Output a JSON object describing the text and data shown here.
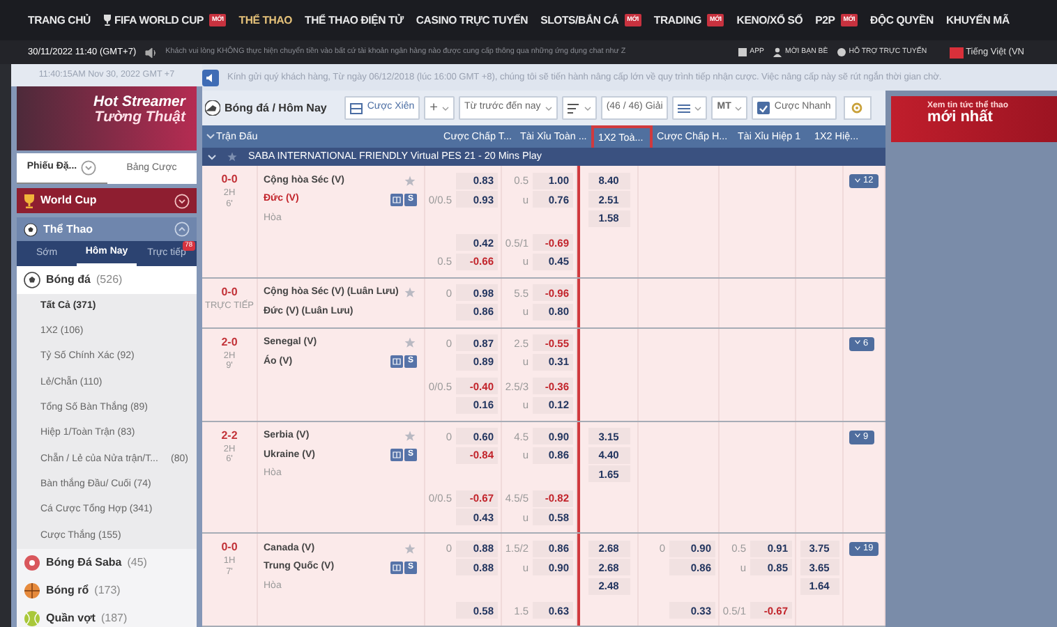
{
  "top_nav": [
    {
      "label": "TRANG CHỦ",
      "selected": false,
      "trophy": false
    },
    {
      "label": "FIFA WORLD CUP",
      "selected": false,
      "trophy": true,
      "badge": "MỚI"
    },
    {
      "label": "THỂ THAO",
      "selected": true,
      "trophy": false
    },
    {
      "label": "THỂ THAO ĐIỆN TỬ",
      "selected": false,
      "trophy": false
    },
    {
      "label": "CASINO TRỰC TUYẾN",
      "selected": false,
      "trophy": false
    },
    {
      "label": "SLOTS/BẮN CÁ",
      "selected": false,
      "trophy": false,
      "badge": "MỚI"
    },
    {
      "label": "TRADING",
      "selected": false,
      "trophy": false,
      "badge": "MỚI"
    },
    {
      "label": "KENO/XỔ SỐ",
      "selected": false,
      "trophy": false
    },
    {
      "label": "P2P",
      "selected": false,
      "trophy": false,
      "badge": "MỚI"
    },
    {
      "label": "ĐỘC QUYỀN",
      "selected": false,
      "trophy": false
    },
    {
      "label": "KHUYẾN MÃ",
      "selected": false,
      "trophy": false
    }
  ],
  "info_bar": {
    "datetime": "30/11/2022 11:40 (GMT+7)",
    "marquee": "Khách vui lòng KHÔNG thực hiện chuyển tiền vào bất cứ tài khoản ngân hàng nào được cung cấp thông qua những ứng dụng chat như Z",
    "links": [
      {
        "kind": "app",
        "label": "APP"
      },
      {
        "kind": "invite",
        "label": "MỜI BẠN BÈ"
      },
      {
        "kind": "support",
        "label": "HỖ TRỢ TRỰC TUYẾN"
      }
    ],
    "language": "Tiếng Việt (VN"
  },
  "sidebar": {
    "clock": "11:40:15AM Nov 30, 2022 GMT +7",
    "banner": {
      "line_1": "Hot Streamer",
      "line_2": "Tường Thuật"
    },
    "bet_tabs": [
      {
        "label": "Phiếu Đặ...",
        "selected": true
      },
      {
        "label": "Bảng Cược",
        "selected": false
      }
    ],
    "world_cup": {
      "label": "World Cup",
      "expanded": false
    },
    "sports_header": {
      "label": "Thể Thao",
      "expanded": true
    },
    "period_tabs": [
      {
        "label": "Sớm",
        "selected": false
      },
      {
        "label": "Hôm Nay",
        "selected": true
      },
      {
        "label": "Trực tiếp",
        "selected": false,
        "badge": "78"
      }
    ],
    "sports": [
      {
        "kind": "soccer",
        "name": "Bóng đá",
        "count": "(526)",
        "children": [
          {
            "label": "Tất Cả (371)",
            "selected": true
          },
          {
            "label": "1X2 (106)",
            "selected": false
          },
          {
            "label": "Tỷ Số Chính Xác (92)",
            "selected": false
          },
          {
            "label": "Lẻ/Chẵn (110)",
            "selected": false
          },
          {
            "label": "Tổng Số Bàn Thắng (89)",
            "selected": false
          },
          {
            "label": "Hiệp 1/Toàn Trận (83)",
            "selected": false
          },
          {
            "label": "Chẵn / Lẻ của Nửa trận/T...",
            "count": "(80)",
            "selected": false
          },
          {
            "label": "Bàn thắng Đầu/ Cuối (74)",
            "selected": false
          },
          {
            "label": "Cá Cược Tổng Hợp (341)",
            "selected": false
          },
          {
            "label": "Cược Thắng (155)",
            "selected": false
          }
        ]
      },
      {
        "kind": "saba",
        "name": "Bóng Đá Saba",
        "count": "(45)"
      },
      {
        "kind": "basketball",
        "name": "Bóng rổ",
        "count": "(173)"
      },
      {
        "kind": "tennis",
        "name": "Quần vợt",
        "count": "(187)"
      }
    ]
  },
  "notice": "Kính gửi quý khách hàng, Từ ngày 06/12/2018 (lúc 16:00 GMT +8), chúng tôi sẽ tiến hành nâng cấp lớn về quy trình tiếp nhận cược. Việc nâng cấp này sẽ rút ngắn thời gian chờ.",
  "toolbar": {
    "title": "Bóng đá / Hôm Nay",
    "parlay": "Cược Xiên",
    "add": "+",
    "period_filter": "Từ trước đến nay",
    "league_count": "(46 / 46) Giải",
    "odds_type": "MT",
    "quick_bet": {
      "label": "Cược Nhanh",
      "checked": true
    }
  },
  "table": {
    "columns": [
      {
        "label": "Trận Đấu",
        "highlighted": false
      },
      {
        "label": "Cược Chấp T...",
        "highlighted": false
      },
      {
        "label": "Tài Xỉu Toàn ...",
        "highlighted": false
      },
      {
        "label": "1X2 Toà...",
        "highlighted": true
      },
      {
        "label": "Cược Chấp H...",
        "highlighted": false
      },
      {
        "label": "Tài Xỉu Hiệp 1",
        "highlighted": false
      },
      {
        "label": "1X2 Hiệ...",
        "highlighted": false
      }
    ],
    "league": {
      "name": "SABA INTERNATIONAL FRIENDLY Virtual PES 21 - 20 Mins Play",
      "expanded": true
    },
    "matches": [
      {
        "score": "0-0",
        "period": "2H",
        "minute": "6'",
        "home": {
          "name": "Cộng hòa Séc (V)",
          "favored": false
        },
        "away": {
          "name": "Đức (V)",
          "favored": true
        },
        "draw": "Hòa",
        "stream_label": "S",
        "more": "12",
        "main_lines": [
          {
            "hdp": {
              "odds": "0.83",
              "negative": false
            },
            "ou_line": "0.5",
            "ou": {
              "odds": "1.00",
              "negative": false
            },
            "x12": "8.40"
          },
          {
            "hdp_line": "0/0.5",
            "hdp": {
              "odds": "0.93",
              "negative": false
            },
            "ou_line": "u",
            "ou": {
              "odds": "0.76",
              "negative": false
            },
            "x12": "2.51"
          },
          {
            "x12": "1.58"
          }
        ],
        "extra_lines": [
          {
            "hdp": {
              "odds": "0.42",
              "negative": false
            },
            "ou_line": "0.5/1",
            "ou": {
              "odds": "-0.69",
              "negative": true
            }
          },
          {
            "hdp_line": "0.5",
            "hdp": {
              "odds": "-0.66",
              "negative": true
            },
            "ou_line": "u",
            "ou": {
              "odds": "0.45",
              "negative": false
            }
          }
        ]
      },
      {
        "score": "0-0",
        "period": "TRỰC TIẾP",
        "home": {
          "name": "Cộng hòa Séc (V) (Luân Lưu)",
          "favored": false
        },
        "away": {
          "name": "Đức (V) (Luân Lưu)",
          "favored": false
        },
        "main_lines": [
          {
            "hdp_line": "0",
            "hdp": {
              "odds": "0.98",
              "negative": false
            },
            "ou_line": "5.5",
            "ou": {
              "odds": "-0.96",
              "negative": true
            }
          },
          {
            "hdp": {
              "odds": "0.86",
              "negative": false
            },
            "ou_line": "u",
            "ou": {
              "odds": "0.80",
              "negative": false
            }
          }
        ]
      },
      {
        "score": "2-0",
        "period": "2H",
        "minute": "9'",
        "home": {
          "name": "Senegal (V)",
          "favored": false
        },
        "away": {
          "name": "Áo (V)",
          "favored": false
        },
        "stream_label": "S",
        "more": "6",
        "main_lines": [
          {
            "hdp_line": "0",
            "hdp": {
              "odds": "0.87",
              "negative": false
            },
            "ou_line": "2.5",
            "ou": {
              "odds": "-0.55",
              "negative": true
            }
          },
          {
            "hdp": {
              "odds": "0.89",
              "negative": false
            },
            "ou_line": "u",
            "ou": {
              "odds": "0.31",
              "negative": false
            }
          }
        ],
        "extra_lines": [
          {
            "hdp_line": "0/0.5",
            "hdp": {
              "odds": "-0.40",
              "negative": true
            },
            "ou_line": "2.5/3",
            "ou": {
              "odds": "-0.36",
              "negative": true
            }
          },
          {
            "hdp": {
              "odds": "0.16",
              "negative": false
            },
            "ou_line": "u",
            "ou": {
              "odds": "0.12",
              "negative": false
            }
          }
        ]
      },
      {
        "score": "2-2",
        "period": "2H",
        "minute": "6'",
        "home": {
          "name": "Serbia (V)",
          "favored": false
        },
        "away": {
          "name": "Ukraine (V)",
          "favored": false
        },
        "draw": "Hòa",
        "stream_label": "S",
        "more": "9",
        "main_lines": [
          {
            "hdp_line": "0",
            "hdp": {
              "odds": "0.60",
              "negative": false
            },
            "ou_line": "4.5",
            "ou": {
              "odds": "0.90",
              "negative": false
            },
            "x12": "3.15"
          },
          {
            "hdp": {
              "odds": "-0.84",
              "negative": true
            },
            "ou_line": "u",
            "ou": {
              "odds": "0.86",
              "negative": false
            },
            "x12": "4.40"
          },
          {
            "x12": "1.65"
          }
        ],
        "extra_lines": [
          {
            "hdp_line": "0/0.5",
            "hdp": {
              "odds": "-0.67",
              "negative": true
            },
            "ou_line": "4.5/5",
            "ou": {
              "odds": "-0.82",
              "negative": true
            }
          },
          {
            "hdp": {
              "odds": "0.43",
              "negative": false
            },
            "ou_line": "u",
            "ou": {
              "odds": "0.58",
              "negative": false
            }
          }
        ]
      },
      {
        "score": "0-0",
        "period": "1H",
        "minute": "7'",
        "home": {
          "name": "Canada (V)",
          "favored": false
        },
        "away": {
          "name": "Trung Quốc (V)",
          "favored": false
        },
        "draw": "Hòa",
        "stream_label": "S",
        "more": "19",
        "main_lines": [
          {
            "hdp_line": "0",
            "hdp": {
              "odds": "0.88",
              "negative": false
            },
            "ou_line": "1.5/2",
            "ou": {
              "odds": "0.86",
              "negative": false
            },
            "x12": "2.68",
            "h1_hdp_line": "0",
            "h1_hdp": {
              "odds": "0.90",
              "negative": false
            },
            "h1_ou_line": "0.5",
            "h1_ou": {
              "odds": "0.91",
              "negative": false
            },
            "h1_x12": "3.75"
          },
          {
            "hdp": {
              "odds": "0.88",
              "negative": false
            },
            "ou_line": "u",
            "ou": {
              "odds": "0.90",
              "negative": false
            },
            "x12": "2.68",
            "h1_hdp": {
              "odds": "0.86",
              "negative": false
            },
            "h1_ou_line": "u",
            "h1_ou": {
              "odds": "0.85",
              "negative": false
            },
            "h1_x12": "3.65"
          },
          {
            "x12": "2.48",
            "h1_x12": "1.64"
          }
        ],
        "extra_lines": [
          {
            "hdp": {
              "odds": "0.58",
              "negative": false
            },
            "ou_line": "1.5",
            "ou": {
              "odds": "0.63",
              "negative": false
            },
            "h1_hdp": {
              "odds": "0.33",
              "negative": false
            },
            "h1_ou_line": "0.5/1",
            "h1_ou": {
              "odds": "-0.67",
              "negative": true
            }
          }
        ]
      }
    ]
  },
  "promo_banner": {
    "line_1": "Xem tin tức thể thao",
    "line_2": "mới nhất"
  }
}
